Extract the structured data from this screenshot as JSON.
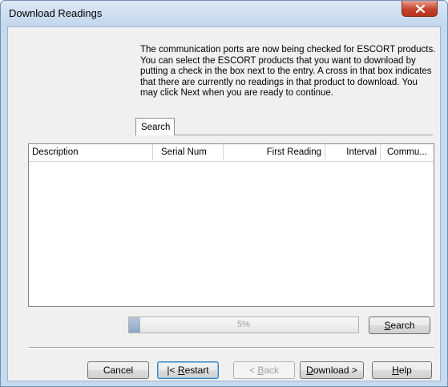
{
  "window": {
    "title": "Download Readings",
    "close_icon": "close-icon"
  },
  "intro_text": "The communication ports are now being checked for ESCORT products. You can select the ESCORT products that you want to download by putting a check in the box next to the entry. A cross in that box indicates that there are currently no readings in that product to download. You may click Next when you are ready to continue.",
  "tabs": [
    {
      "label": "Search",
      "selected": true
    }
  ],
  "table": {
    "columns": [
      "Description",
      "Serial Num",
      "First Reading",
      "Interval",
      "Commu..."
    ],
    "rows": []
  },
  "progress": {
    "value": 5,
    "label": "5%"
  },
  "buttons": {
    "search": {
      "prefix": "",
      "mnemonic": "S",
      "suffix": "earch"
    },
    "cancel": {
      "label": "Cancel"
    },
    "restart": {
      "prefix": "|< ",
      "mnemonic": "R",
      "suffix": "estart"
    },
    "back": {
      "prefix": "< ",
      "mnemonic": "B",
      "suffix": "ack"
    },
    "download": {
      "prefix": "",
      "mnemonic": "D",
      "suffix": "ownload >"
    },
    "help": {
      "prefix": "",
      "mnemonic": "H",
      "suffix": "elp"
    }
  },
  "colors": {
    "frame": "#c6d9ee",
    "close_button": "#c5442b",
    "progress_fill": "#8da6c4"
  }
}
